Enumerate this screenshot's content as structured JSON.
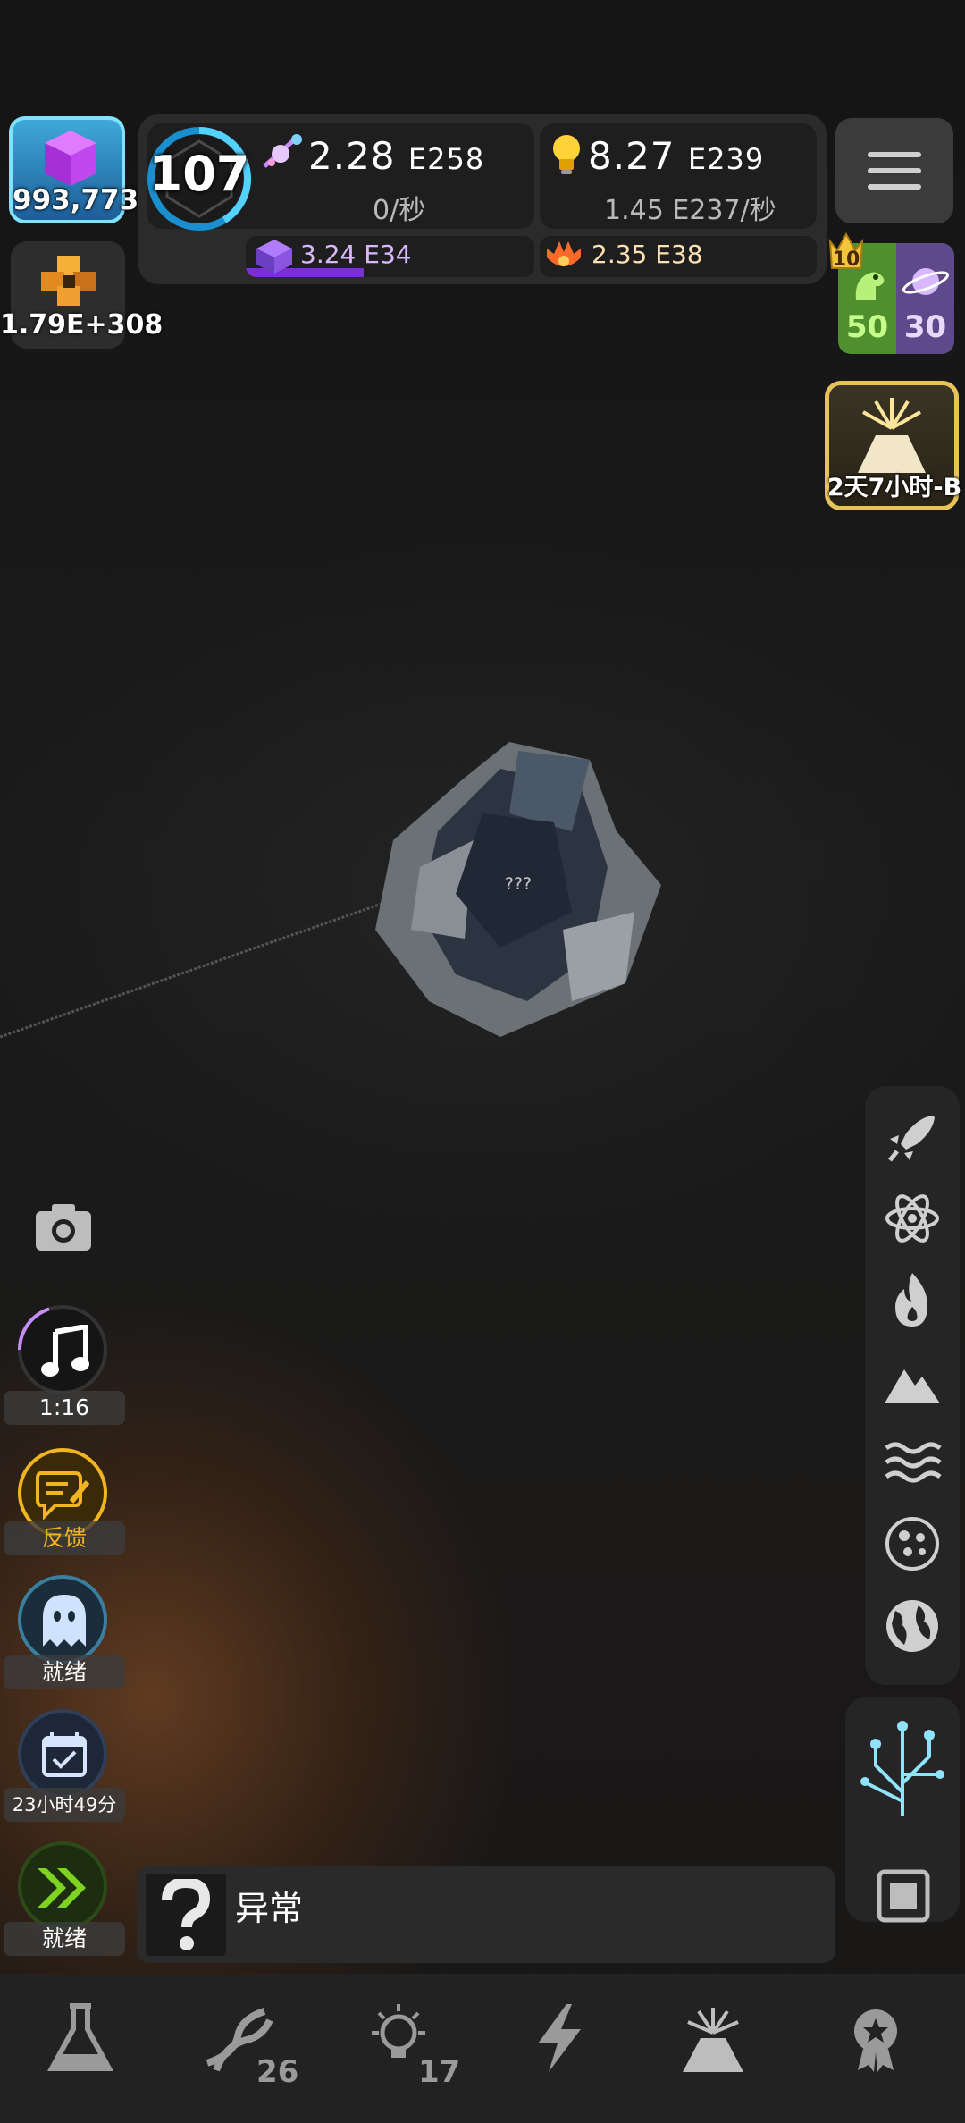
{
  "currencies": {
    "cubes": "993,773",
    "puzzle": "1.79E+308"
  },
  "stats": {
    "level": "107",
    "matter_value": "2.28",
    "matter_exp": "E258",
    "matter_rate": "0/秒",
    "idea_value": "8.27",
    "idea_exp": "E239",
    "idea_rate": "1.45",
    "idea_rate_exp": "E237/秒",
    "dimension_value": "3.24",
    "dimension_exp": "E34",
    "dimension_progress": 0.41,
    "fire_value": "2.35",
    "fire_exp": "E38"
  },
  "badges": {
    "crown_level": "10",
    "dino_count": "50",
    "planet_count": "30"
  },
  "event": {
    "timer": "2天7小时-B"
  },
  "center": {
    "object_label": "???"
  },
  "left_panel": {
    "music_timer": "1:16",
    "feedback_label": "反馈",
    "ghost_label": "就绪",
    "calendar_label": "23小时49分",
    "skip_label": "就绪"
  },
  "anomaly": {
    "label": "异常"
  },
  "bottom_nav": {
    "dna_badge": "26",
    "idea_badge": "17"
  },
  "colors": {
    "accent_purple": "#7b2fcf",
    "accent_gold": "#e7c35a",
    "ready_green": "#7ed321",
    "cyan": "#7fe3ff"
  }
}
